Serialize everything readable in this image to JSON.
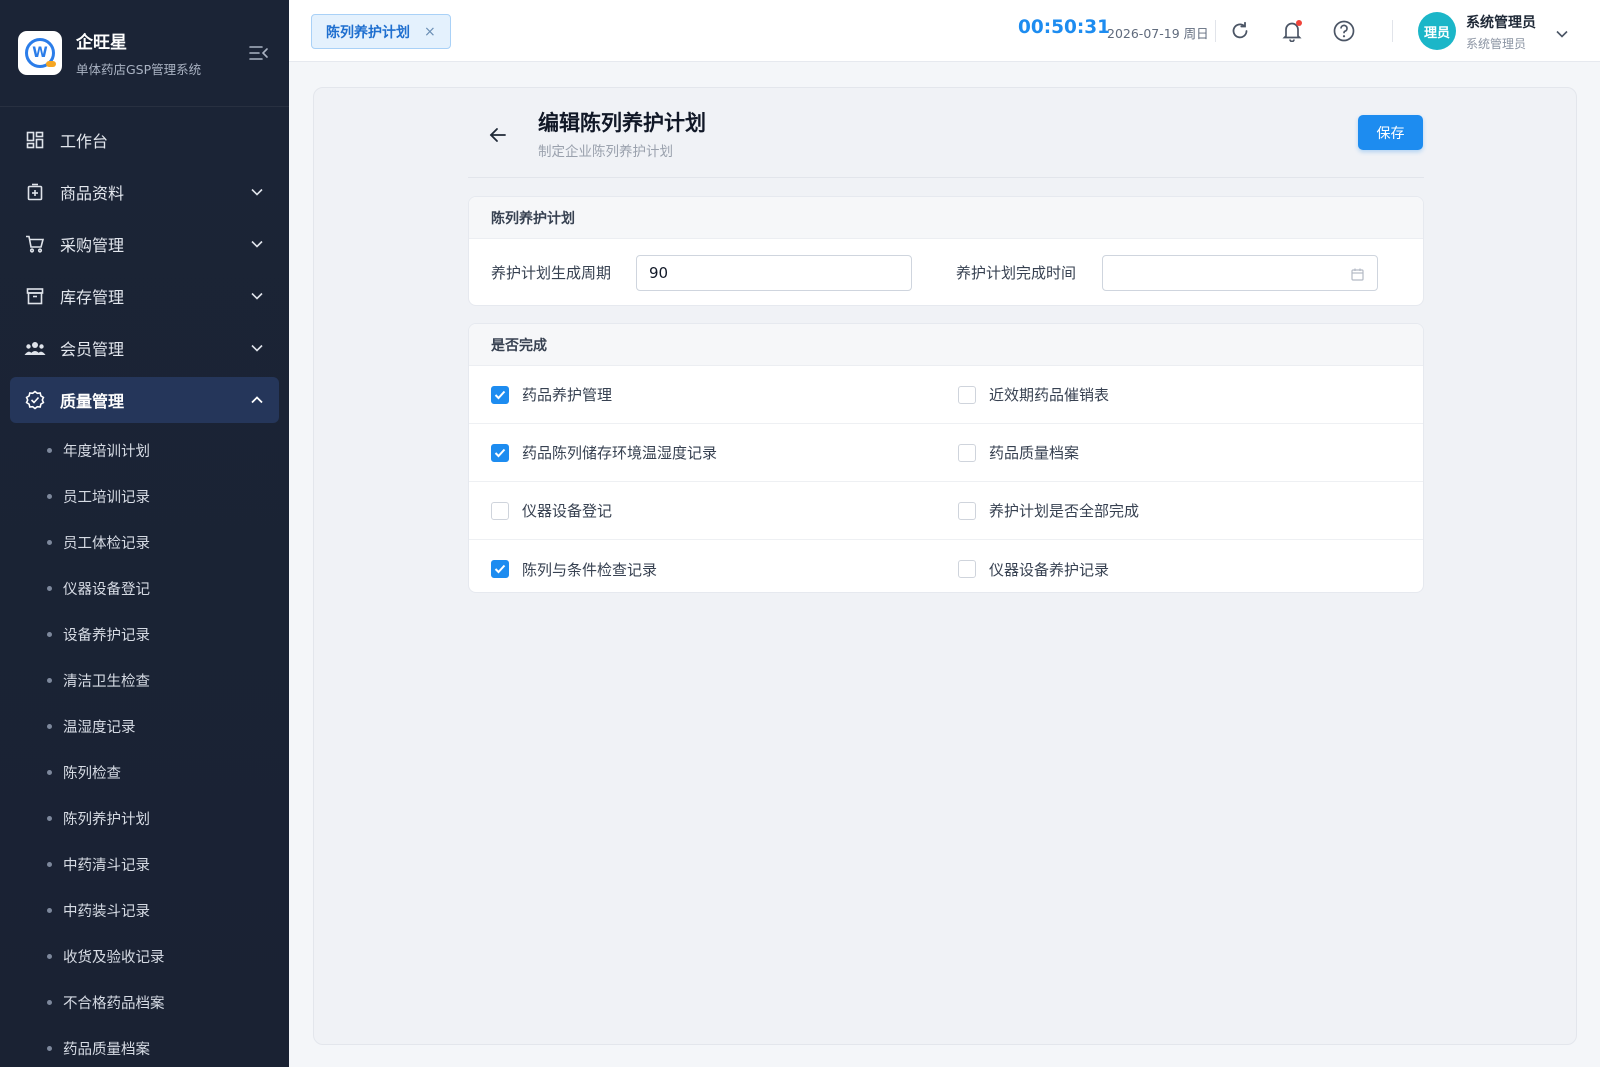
{
  "app": {
    "name": "企旺星",
    "subtitle": "单体药店GSP管理系统",
    "logo_letter": "W"
  },
  "sidebar": {
    "menu": [
      {
        "label": "工作台",
        "icon": "dashboard-icon",
        "expandable": false
      },
      {
        "label": "商品资料",
        "icon": "product-icon",
        "expandable": true
      },
      {
        "label": "采购管理",
        "icon": "cart-icon",
        "expandable": true
      },
      {
        "label": "库存管理",
        "icon": "archive-icon",
        "expandable": true
      },
      {
        "label": "会员管理",
        "icon": "users-icon",
        "expandable": true
      },
      {
        "label": "质量管理",
        "icon": "quality-badge-icon",
        "expandable": true,
        "active": true
      }
    ],
    "quality_submenu": [
      "年度培训计划",
      "员工培训记录",
      "员工体检记录",
      "仪器设备登记",
      "设备养护记录",
      "清洁卫生检查",
      "温湿度记录",
      "陈列检查",
      "陈列养护计划",
      "中药清斗记录",
      "中药装斗记录",
      "收货及验收记录",
      "不合格药品档案",
      "药品质量档案"
    ]
  },
  "header": {
    "tab_label": "陈列养护计划",
    "tab_close": "×",
    "clock": "00:50:31",
    "date": "2026-07-19 周日",
    "avatar_text": "理员",
    "user_name": "系统管理员",
    "user_role": "系统管理员"
  },
  "page": {
    "title": "编辑陈列养护计划",
    "subtitle": "制定企业陈列养护计划",
    "save_label": "保存"
  },
  "plan_section": {
    "title": "陈列养护计划",
    "cycle_label": "养护计划生成周期",
    "cycle_value": "90",
    "finish_time_label": "养护计划完成时间",
    "finish_time_value": ""
  },
  "completion_section": {
    "title": "是否完成",
    "rows": [
      [
        {
          "label": "药品养护管理",
          "checked": true
        },
        {
          "label": "近效期药品催销表",
          "checked": false
        }
      ],
      [
        {
          "label": "药品陈列储存环境温湿度记录",
          "checked": true
        },
        {
          "label": "药品质量档案",
          "checked": false
        }
      ],
      [
        {
          "label": "仪器设备登记",
          "checked": false
        },
        {
          "label": "养护计划是否全部完成",
          "checked": false
        }
      ],
      [
        {
          "label": "陈列与条件检查记录",
          "checked": true
        },
        {
          "label": "仪器设备养护记录",
          "checked": false
        }
      ]
    ]
  },
  "colors": {
    "primary": "#1d8cf0",
    "sidebar_bg": "#1b2436",
    "sidebar_active": "#25365a",
    "notification_dot": "#f0443a",
    "avatar_bg": "#1bb6c8"
  }
}
